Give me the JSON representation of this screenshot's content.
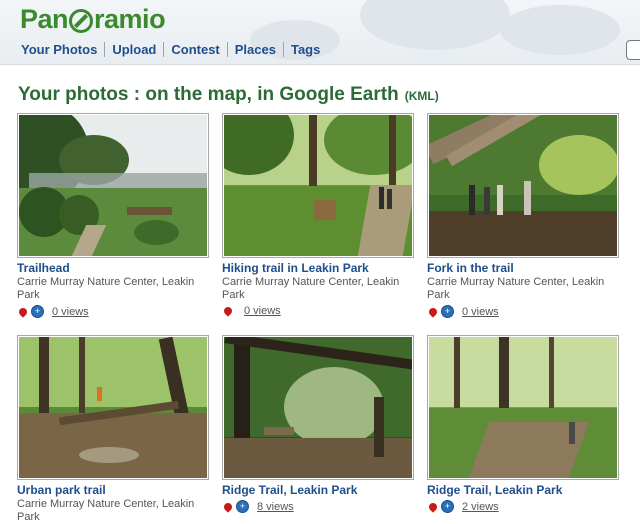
{
  "header": {
    "logo_text_1": "Pan",
    "logo_text_2": "ramio",
    "nav": [
      "Your Photos",
      "Upload",
      "Contest",
      "Places",
      "Tags"
    ]
  },
  "page": {
    "title": "Your photos : on the map, in Google Earth",
    "kml": "(KML)"
  },
  "photos": [
    {
      "caption": "Trailhead",
      "place": "Carrie Murray Nature Center, Leakin Park",
      "views": "0 views",
      "earth": true
    },
    {
      "caption": "Hiking trail in Leakin Park",
      "place": "Carrie Murray Nature Center, Leakin Park",
      "views": "0 views",
      "earth": false
    },
    {
      "caption": "Fork in the trail",
      "place": "Carrie Murray Nature Center, Leakin Park",
      "views": "0 views",
      "earth": true
    },
    {
      "caption": "Urban park trail",
      "place": "Carrie Murray Nature Center, Leakin Park",
      "views": "",
      "earth": false
    },
    {
      "caption": "Ridge Trail, Leakin Park",
      "place": "",
      "views": "8 views",
      "earth": true
    },
    {
      "caption": "Ridge Trail, Leakin Park",
      "place": "",
      "views": "2 views",
      "earth": true
    }
  ],
  "colors": {
    "brand": "#3b8a2e",
    "link": "#1e4e8c",
    "title": "#2c6b37"
  }
}
